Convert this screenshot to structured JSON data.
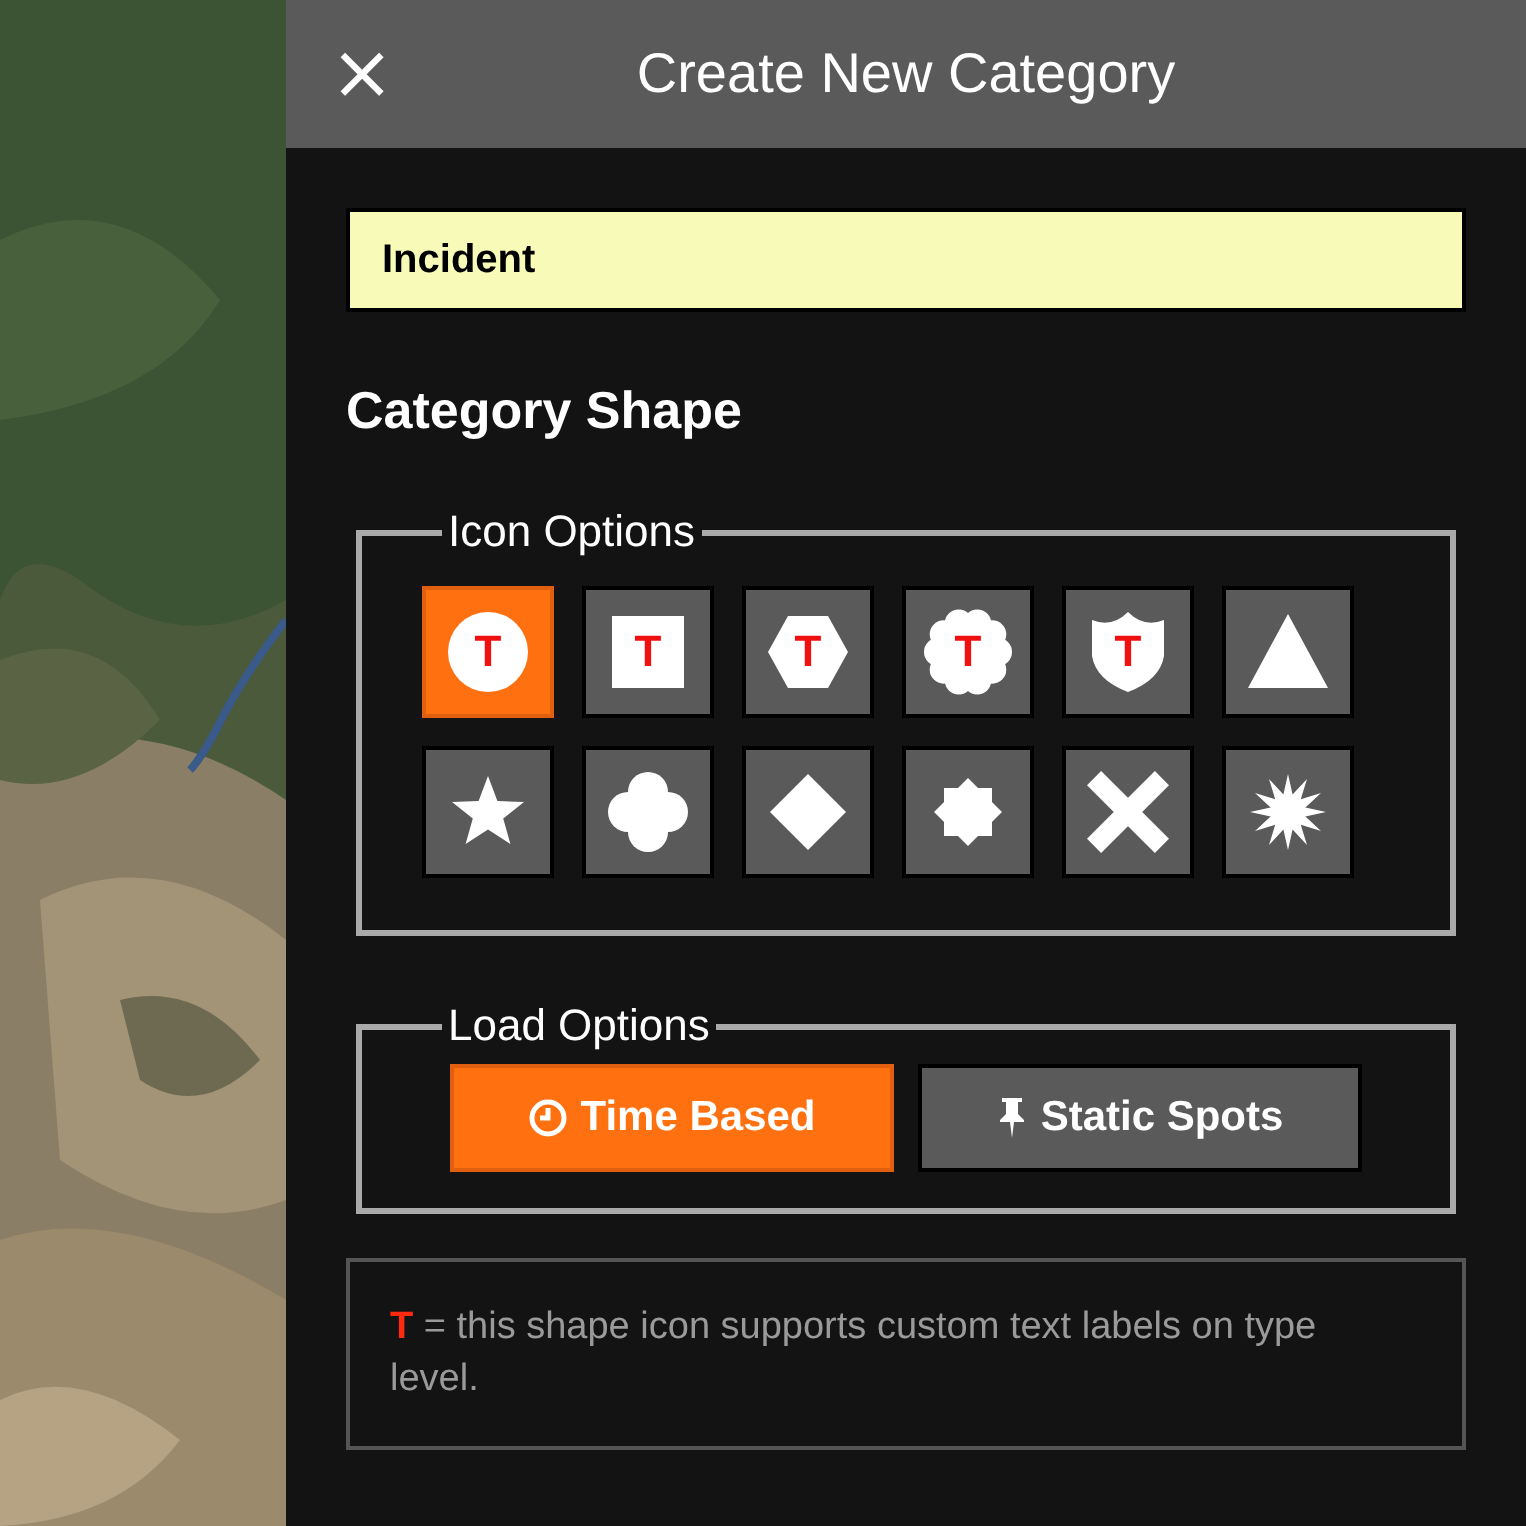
{
  "dialog": {
    "title": "Create New Category",
    "close": "×"
  },
  "name_field": {
    "value": "Incident"
  },
  "section_title": "Category Shape",
  "icon_options": {
    "legend": "Icon Options",
    "items": [
      {
        "kind": "circle",
        "label": "T",
        "selected": true
      },
      {
        "kind": "square",
        "label": "T",
        "selected": false
      },
      {
        "kind": "hexagon",
        "label": "T",
        "selected": false
      },
      {
        "kind": "scallop",
        "label": "T",
        "selected": false
      },
      {
        "kind": "shield",
        "label": "T",
        "selected": false
      },
      {
        "kind": "triangle",
        "selected": false
      },
      {
        "kind": "star",
        "selected": false
      },
      {
        "kind": "clover",
        "selected": false
      },
      {
        "kind": "diamond",
        "selected": false
      },
      {
        "kind": "octagram",
        "selected": false
      },
      {
        "kind": "cross",
        "selected": false
      },
      {
        "kind": "burst",
        "selected": false
      }
    ]
  },
  "load_options": {
    "legend": "Load Options",
    "items": [
      {
        "kind": "clock",
        "label": "Time Based",
        "selected": true
      },
      {
        "kind": "pin",
        "label": "Static Spots",
        "selected": false
      }
    ]
  },
  "note": {
    "marker": "T",
    "text": "= this shape icon supports custom text labels on type level."
  }
}
